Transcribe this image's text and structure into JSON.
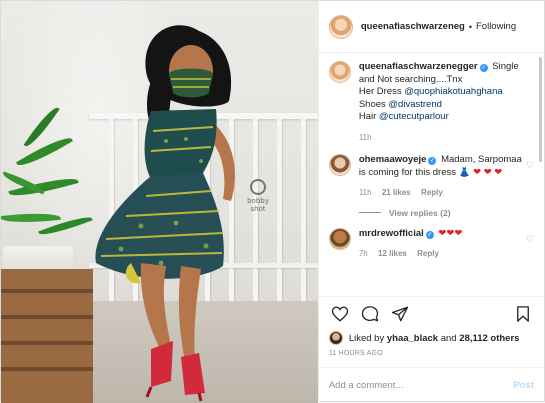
{
  "post": {
    "image_watermark": "bobby\nshot",
    "author": "queenafiaschwarzeneg",
    "follow_sep": "•",
    "follow_status": "Following"
  },
  "caption": {
    "user": "queenafiaschwarzenegger",
    "text_1": "Single and Not searching....Tnx",
    "dress_label": "Her Dress",
    "dress_tag": "@quophiakotuahghana",
    "shoes_label": "Shoes",
    "shoes_tag": "@divastrend",
    "hair_label": "Hair",
    "hair_tag": "@cutecutparlour",
    "time": "11h"
  },
  "comments": [
    {
      "user": "ohemaawoyeje",
      "text": "Madam, Sarpomaa is coming for this dress",
      "emojis": "👗 ❤ ❤ ❤",
      "time": "11h",
      "likes": "21 likes",
      "reply": "Reply",
      "view_replies": "View replies (2)"
    },
    {
      "user": "mrdrewofficial",
      "emojis": "❤❤❤",
      "time": "7h",
      "likes": "12 likes",
      "reply": "Reply"
    }
  ],
  "likes": {
    "prefix": "Liked by",
    "user": "yhaa_black",
    "and": "and",
    "count": "28,112 others"
  },
  "timestamp": "11 HOURS AGO",
  "add_comment": {
    "placeholder": "Add a comment...",
    "post_label": "Post"
  },
  "colors": {
    "link": "#00376b",
    "verified": "#3897f0",
    "post_button_disabled": "#b2dffc",
    "muted": "#8e8e8e"
  },
  "icons": [
    "heart-icon",
    "comment-icon",
    "share-icon",
    "bookmark-icon",
    "verified-icon"
  ]
}
